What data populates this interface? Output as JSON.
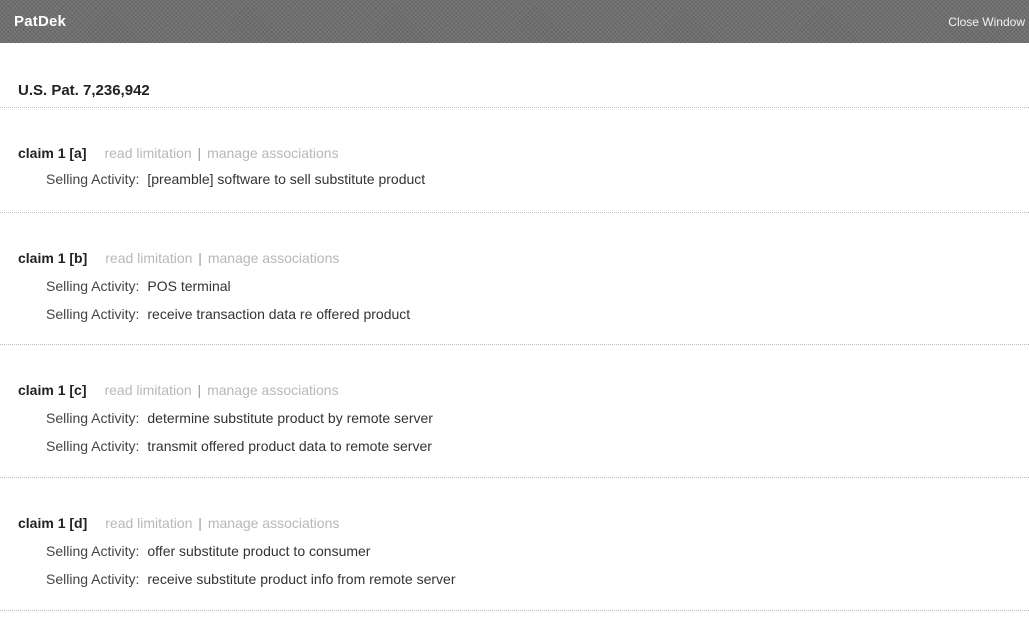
{
  "window": {
    "app_name": "PatDek",
    "close_label": "Close Window"
  },
  "patent": {
    "number": "U.S. Pat. 7,236,942"
  },
  "claims": [
    {
      "id": "claim 1 [a]",
      "actions": [
        "read limitation",
        "manage associations"
      ],
      "separator": "|",
      "activities": [
        {
          "label": "Selling Activity:",
          "text": "[preamble] software to sell substitute product"
        }
      ]
    },
    {
      "id": "claim 1 [b]",
      "actions": [
        "read limitation",
        "manage associations"
      ],
      "separator": "|",
      "activities": [
        {
          "label": "Selling Activity:",
          "text": "POS terminal"
        },
        {
          "label": "Selling Activity:",
          "text": "receive transaction data re offered product"
        }
      ]
    },
    {
      "id": "claim 1 [c]",
      "actions": [
        "read limitation",
        "manage associations"
      ],
      "separator": "|",
      "activities": [
        {
          "label": "Selling Activity:",
          "text": "determine substitute product by remote server"
        },
        {
          "label": "Selling Activity:",
          "text": "transmit offered product data to remote server"
        }
      ]
    },
    {
      "id": "claim 1 [d]",
      "actions": [
        "read limitation",
        "manage associations"
      ],
      "separator": "|",
      "activities": [
        {
          "label": "Selling Activity:",
          "text": "offer substitute product to consumer"
        },
        {
          "label": "Selling Activity:",
          "text": "receive substitute product info from remote server"
        }
      ]
    }
  ]
}
